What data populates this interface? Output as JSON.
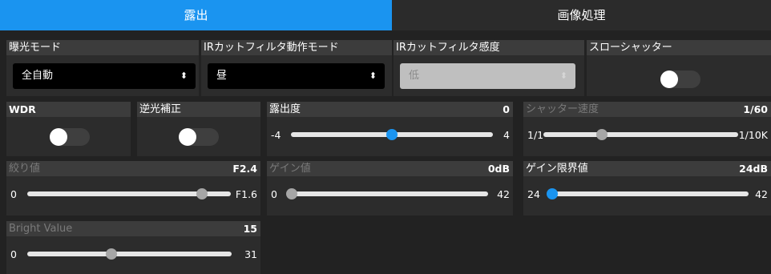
{
  "tabs": {
    "exposure": "露出",
    "image": "画像処理"
  },
  "exposure_mode": {
    "label": "曝光モード",
    "value": "全自動"
  },
  "ir_cut_filter_mode": {
    "label": "IRカットフィルタ動作モード",
    "value": "昼"
  },
  "ir_cut_filter_sensitivity": {
    "label": "IRカットフィルタ感度",
    "value": "低"
  },
  "slow_shutter": {
    "label": "スローシャッター",
    "on": false
  },
  "wdr": {
    "label": "WDR",
    "on": false
  },
  "backlight_comp": {
    "label": "逆光補正",
    "on": false
  },
  "exposure_level": {
    "label": "露出度",
    "value": "0",
    "min": "-4",
    "max": "4",
    "fraction": 0.5
  },
  "shutter_speed": {
    "label": "シャッター速度",
    "value": "1/60",
    "min": "1/1",
    "max": "1/10K",
    "fraction": 0.3
  },
  "iris": {
    "label": "絞り値",
    "value": "F2.4",
    "min": "0",
    "max": "F1.6",
    "fraction": 0.86
  },
  "gain": {
    "label": "ゲイン値",
    "value": "0dB",
    "min": "0",
    "max": "42",
    "fraction": 0.0
  },
  "gain_limit": {
    "label": "ゲイン限界値",
    "value": "24dB",
    "min": "24",
    "max": "42",
    "fraction": 0.0
  },
  "bright_value": {
    "label": "Bright Value",
    "value": "15",
    "min": "0",
    "max": "31",
    "fraction": 0.41
  },
  "colors": {
    "accent": "#1a94f0",
    "background": "#222222",
    "panel": "#2c2c2c",
    "header": "#3c3c3c"
  },
  "icons": {
    "select_arrow": "select-updown-icon"
  }
}
